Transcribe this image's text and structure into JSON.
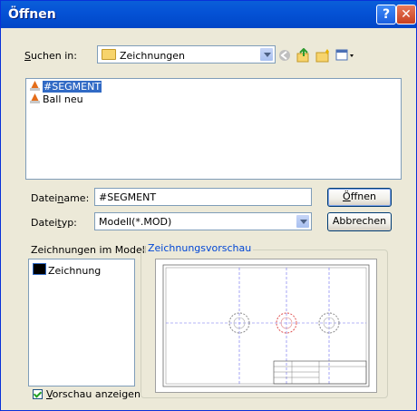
{
  "window": {
    "title": "Öffnen"
  },
  "look_in": {
    "label_pre": "",
    "label_u": "S",
    "label_post": "uchen in:",
    "value": "Zeichnungen"
  },
  "files": [
    {
      "name": "#SEGMENT",
      "selected": true
    },
    {
      "name": "Ball neu",
      "selected": false
    }
  ],
  "filename": {
    "label_pre": "Datei",
    "label_u": "n",
    "label_post": "ame:",
    "value": "#SEGMENT"
  },
  "filetype": {
    "label_pre": "Datei",
    "label_u": "t",
    "label_post": "yp:",
    "value": "Modell(*.MOD)"
  },
  "buttons": {
    "open_pre": "",
    "open_u": "Ö",
    "open_post": "ffnen",
    "cancel": "Abbrechen"
  },
  "drawings": {
    "label": "Zeichnungen im Modell:",
    "items": [
      "Zeichnung"
    ]
  },
  "preview": {
    "title": "Zeichnungsvorschau"
  },
  "show_preview": {
    "label_pre": "",
    "label_u": "V",
    "label_post": "orschau anzeigen",
    "checked": true
  },
  "colors": {
    "accent": "#316ac5",
    "titlebar": "#0553d6",
    "group_title": "#0046d5"
  }
}
